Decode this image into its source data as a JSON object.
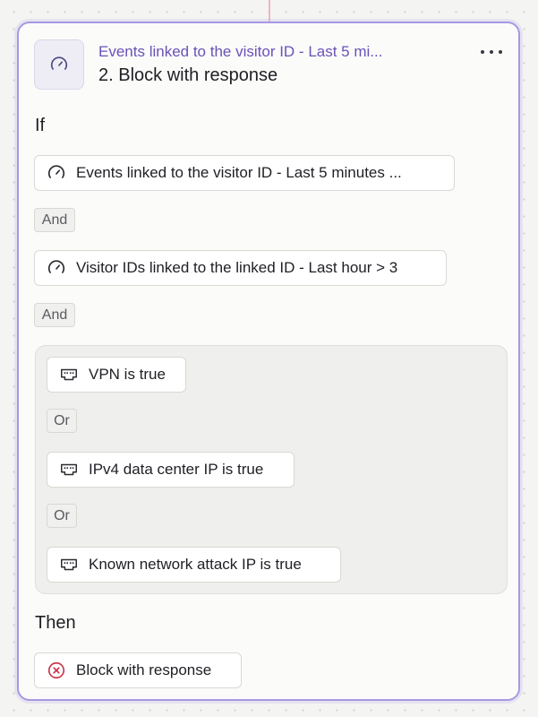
{
  "header": {
    "subtitle": "Events linked to the visitor ID - Last 5 mi...",
    "title": "2. Block with response",
    "icon": "gauge-icon",
    "menu_icon": "more-horizontal-icon"
  },
  "if_label": "If",
  "then_label": "Then",
  "conditions": [
    {
      "label": "Events linked to the visitor ID - Last 5 minutes ...",
      "icon": "gauge-icon"
    },
    {
      "label": "Visitor IDs linked to the linked ID - Last hour > 3",
      "icon": "gauge-icon"
    }
  ],
  "and_label": "And",
  "or_label": "Or",
  "group": {
    "items": [
      {
        "label": "VPN is true",
        "icon": "network-port-icon"
      },
      {
        "label": "IPv4 data center IP is true",
        "icon": "network-port-icon"
      },
      {
        "label": "Known network attack IP is true",
        "icon": "network-port-icon"
      }
    ]
  },
  "action": {
    "label": "Block with response",
    "icon": "x-circle-icon",
    "color": "#c8364a"
  },
  "colors": {
    "accent": "#a898e4",
    "subtitle": "#6a52b8",
    "connector": "#e9b7c4"
  }
}
